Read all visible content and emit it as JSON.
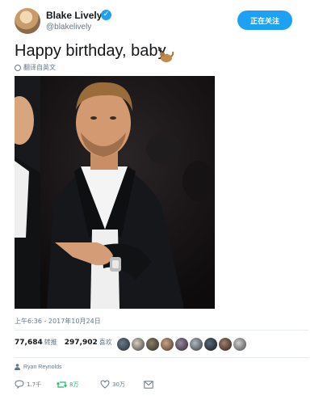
{
  "tweet": {
    "author": {
      "display_name": "Blake Lively",
      "handle": "@blakelively",
      "verified": true
    },
    "follow_button_label": "正在关注",
    "text": "Happy birthday, baby.",
    "emoji": "weasel-emoji",
    "translate_label": "翻译自英文",
    "timestamp": "上午6:36 - 2017年10月24日",
    "retweet_count": "77,684",
    "retweet_label": "转推",
    "like_count": "297,902",
    "like_label": "喜欢",
    "reply_context": "Ryan Reynolds",
    "actions": {
      "reply_count": "1.7千",
      "retweet_count": "8万",
      "like_count": "30万"
    }
  },
  "colors": {
    "twitter_blue": "#1da1f2",
    "retweet_green": "#17bf63",
    "muted_gray": "#657786"
  }
}
